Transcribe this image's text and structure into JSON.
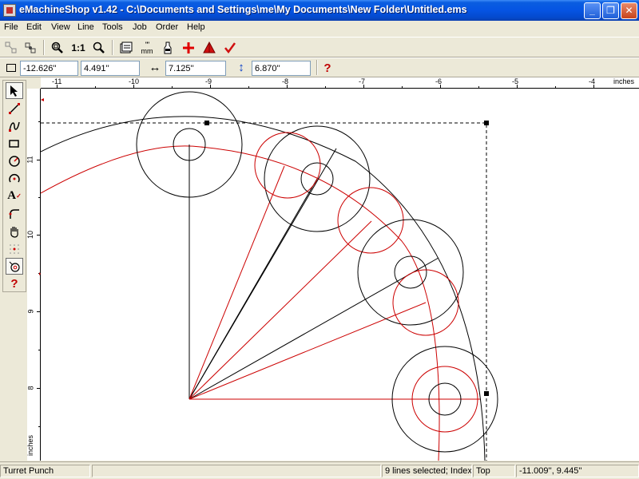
{
  "window": {
    "title": "eMachineShop v1.42 - C:\\Documents and Settings\\me\\My Documents\\New Folder\\Untitled.ems",
    "min_glyph": "_",
    "max_glyph": "❐",
    "close_glyph": "✕"
  },
  "menu": [
    "File",
    "Edit",
    "View",
    "Line",
    "Tools",
    "Job",
    "Order",
    "Help"
  ],
  "toolbar": {
    "scale_label": "1:1",
    "mm_label": "mm",
    "help_glyph": "?"
  },
  "dimensions": {
    "x": "-12.626''",
    "y": "4.491''",
    "width": "7.125''",
    "height": "6.870''",
    "width_glyph": "↔",
    "height_glyph": "↕",
    "help_glyph": "?"
  },
  "rulers": {
    "unit": "inches",
    "top_ticks": [
      "-11",
      "-10",
      "-9",
      "-8",
      "-7",
      "-6",
      "-5",
      "-4"
    ],
    "left_ticks": [
      "11",
      "10",
      "9",
      "8"
    ]
  },
  "status": {
    "mode": "Turret Punch",
    "selection": "9 lines selected; Index",
    "view": "Top",
    "coords": "-11.009'', 9.445''"
  },
  "colors": {
    "titlebar": "#0554e3",
    "sketch_black": "#000000",
    "sketch_red": "#cc0000",
    "canvas": "#ffffff"
  }
}
